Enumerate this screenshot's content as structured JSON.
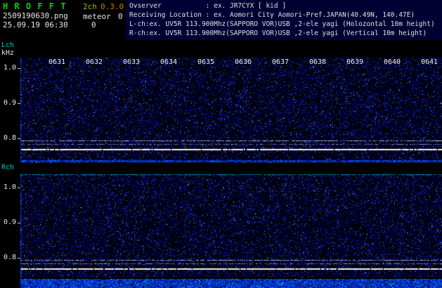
{
  "titlebar": {
    "app_name": "H R O F F T",
    "channel_mode": "2ch",
    "version": "0.3.0",
    "filename": "2509190630.png",
    "mode_label": "meteor",
    "count_top": "0",
    "datetime": "25.09.19 06:30",
    "count_bottom": "0"
  },
  "info_header": {
    "line1": "Ovserver           : ex. JR7CYX [ kid ]",
    "line2": "Receiving Location : ex. Aomori City Aomori-Pref.JAPAN(40.49N, 140.47E)",
    "line3": "L-ch:ex. UV5R 113.900Mhz(SAPPORO VOR)USB ,2-ele yagi (Holozontal 10m height)",
    "line4": "R-ch:ex. UV5R 113.900Mhz(SAPPORO VOR)USB ,2-ele yagi (Vertical 10m height)"
  },
  "lch_panel": {
    "channel_label": "Lch",
    "unit_label": "kHz",
    "freq_ticks": [
      "1.0",
      "0.9",
      "0.8"
    ]
  },
  "rch_panel": {
    "channel_label": "Rch",
    "freq_ticks": [
      "1.0",
      "0.9",
      "0.8"
    ]
  },
  "time_axis": {
    "labels": [
      "0631",
      "0632",
      "0633",
      "0634",
      "0635",
      "0636",
      "0637",
      "0638",
      "0639",
      "0640",
      "0641"
    ]
  },
  "colors": {
    "title_green": "#00d400",
    "channel_mode_yellow": "#b4aa00",
    "version_orange": "#c87800",
    "info_header_bg": "#000033",
    "text_white": "#e6e6e6",
    "channel_label_cyan": "#00c8c8",
    "noise_blue": "#0028d2",
    "noise_bright_blue": "#2a64ff",
    "carrier_line": "#f8f4cc",
    "level_strip_blue": "#0046ff"
  }
}
